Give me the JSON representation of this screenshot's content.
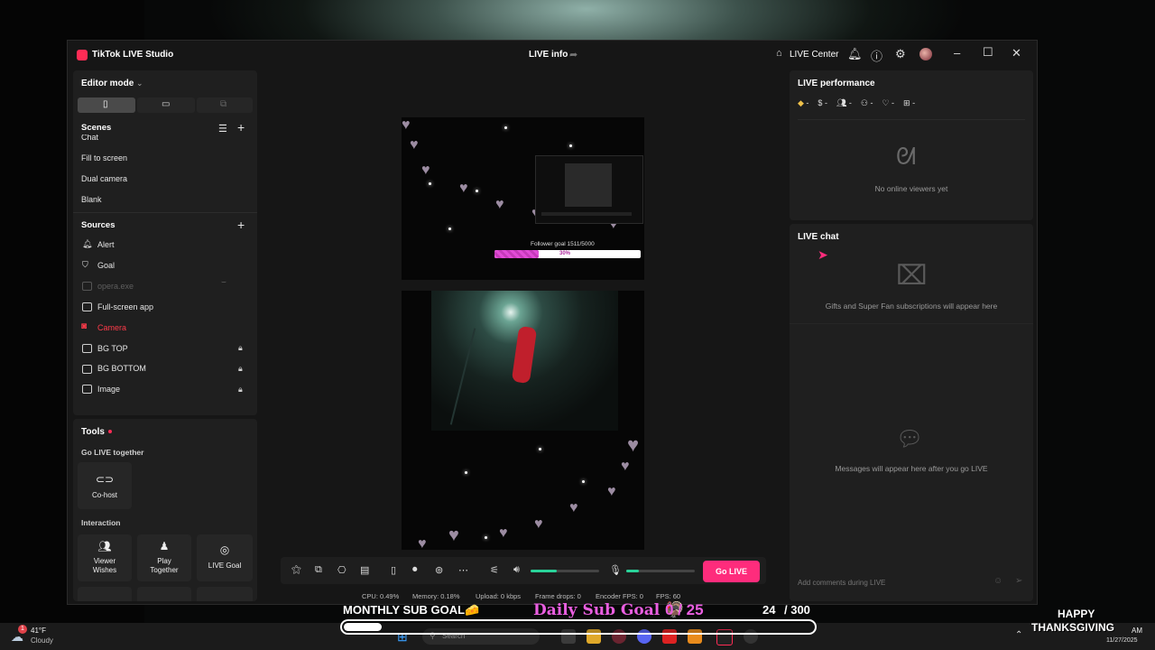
{
  "window": {
    "app_title": "TikTok LIVE Studio",
    "center_title": "LIVE info",
    "live_center": "LIVE Center"
  },
  "editor": {
    "mode_label": "Editor mode"
  },
  "scenes": {
    "title": "Scenes",
    "items": [
      "Chat",
      "Fill to screen",
      "Dual camera",
      "Blank"
    ]
  },
  "sources": {
    "title": "Sources",
    "items": [
      {
        "label": "Alert",
        "icon": "bell-icon",
        "locked": false
      },
      {
        "label": "Goal",
        "icon": "shield-icon",
        "locked": false
      },
      {
        "label": "opera.exe",
        "icon": "window-icon",
        "locked": false,
        "dimmed": true
      },
      {
        "label": "Full-screen app",
        "icon": "monitor-icon",
        "locked": false
      },
      {
        "label": "Camera",
        "icon": "camera-icon",
        "locked": false,
        "highlight": true
      },
      {
        "label": "BG TOP",
        "icon": "image-icon",
        "locked": true
      },
      {
        "label": "BG BOTTOM",
        "icon": "image-icon",
        "locked": true
      },
      {
        "label": "Image",
        "icon": "image-icon",
        "locked": true
      }
    ]
  },
  "tools": {
    "title": "Tools",
    "go_live_together": "Go LIVE together",
    "cohost": "Co-host",
    "interaction": "Interaction",
    "viewer_wishes_1": "Viewer",
    "viewer_wishes_2": "Wishes",
    "play_together_1": "Play",
    "play_together_2": "Together",
    "live_goal": "LIVE Goal"
  },
  "preview": {
    "follower_goal": "Follower goal 1511/5000",
    "follower_percent": "30%",
    "follower_progress": 0.3
  },
  "controls": {
    "go_live": "Go LIVE",
    "volume_level": 0.38,
    "mic_level": 0.18
  },
  "stats": {
    "cpu": "CPU: 0.49%",
    "memory": "Memory: 0.18%",
    "upload": "Upload: 0 kbps",
    "frame_drops": "Frame drops: 0",
    "encoder_fps": "Encoder FPS: 0",
    "fps": "FPS: 60"
  },
  "performance": {
    "title": "LIVE performance",
    "empty": "No online viewers yet"
  },
  "chat": {
    "title": "LIVE chat",
    "gifts_empty": "Gifts and Super Fan subscriptions will appear here",
    "messages_empty": "Messages will appear here after you go LIVE",
    "input_placeholder": "Add comments during LIVE"
  },
  "overlay": {
    "monthly_goal": "MONTHLY SUB GOAL🧀",
    "daily_goal": "Daily Sub Goal 🦃",
    "daily_count": "0 / 25",
    "count_a": "24",
    "count_b": "/ 300",
    "monthly_progress": 0.08,
    "happy": "HAPPY",
    "thanksgiving": "THANKSGIVING"
  },
  "taskbar": {
    "temp": "41°F",
    "weather": "Cloudy",
    "weather_badge": "1",
    "search": "Search",
    "clock_time": "AM",
    "clock_date": "11/27/2025"
  },
  "colors": {
    "accent": "#fe2c7c",
    "camera_red": "#ff3b4a",
    "slider_green": "#29d39a",
    "goal_pink": "#e14bd6"
  }
}
